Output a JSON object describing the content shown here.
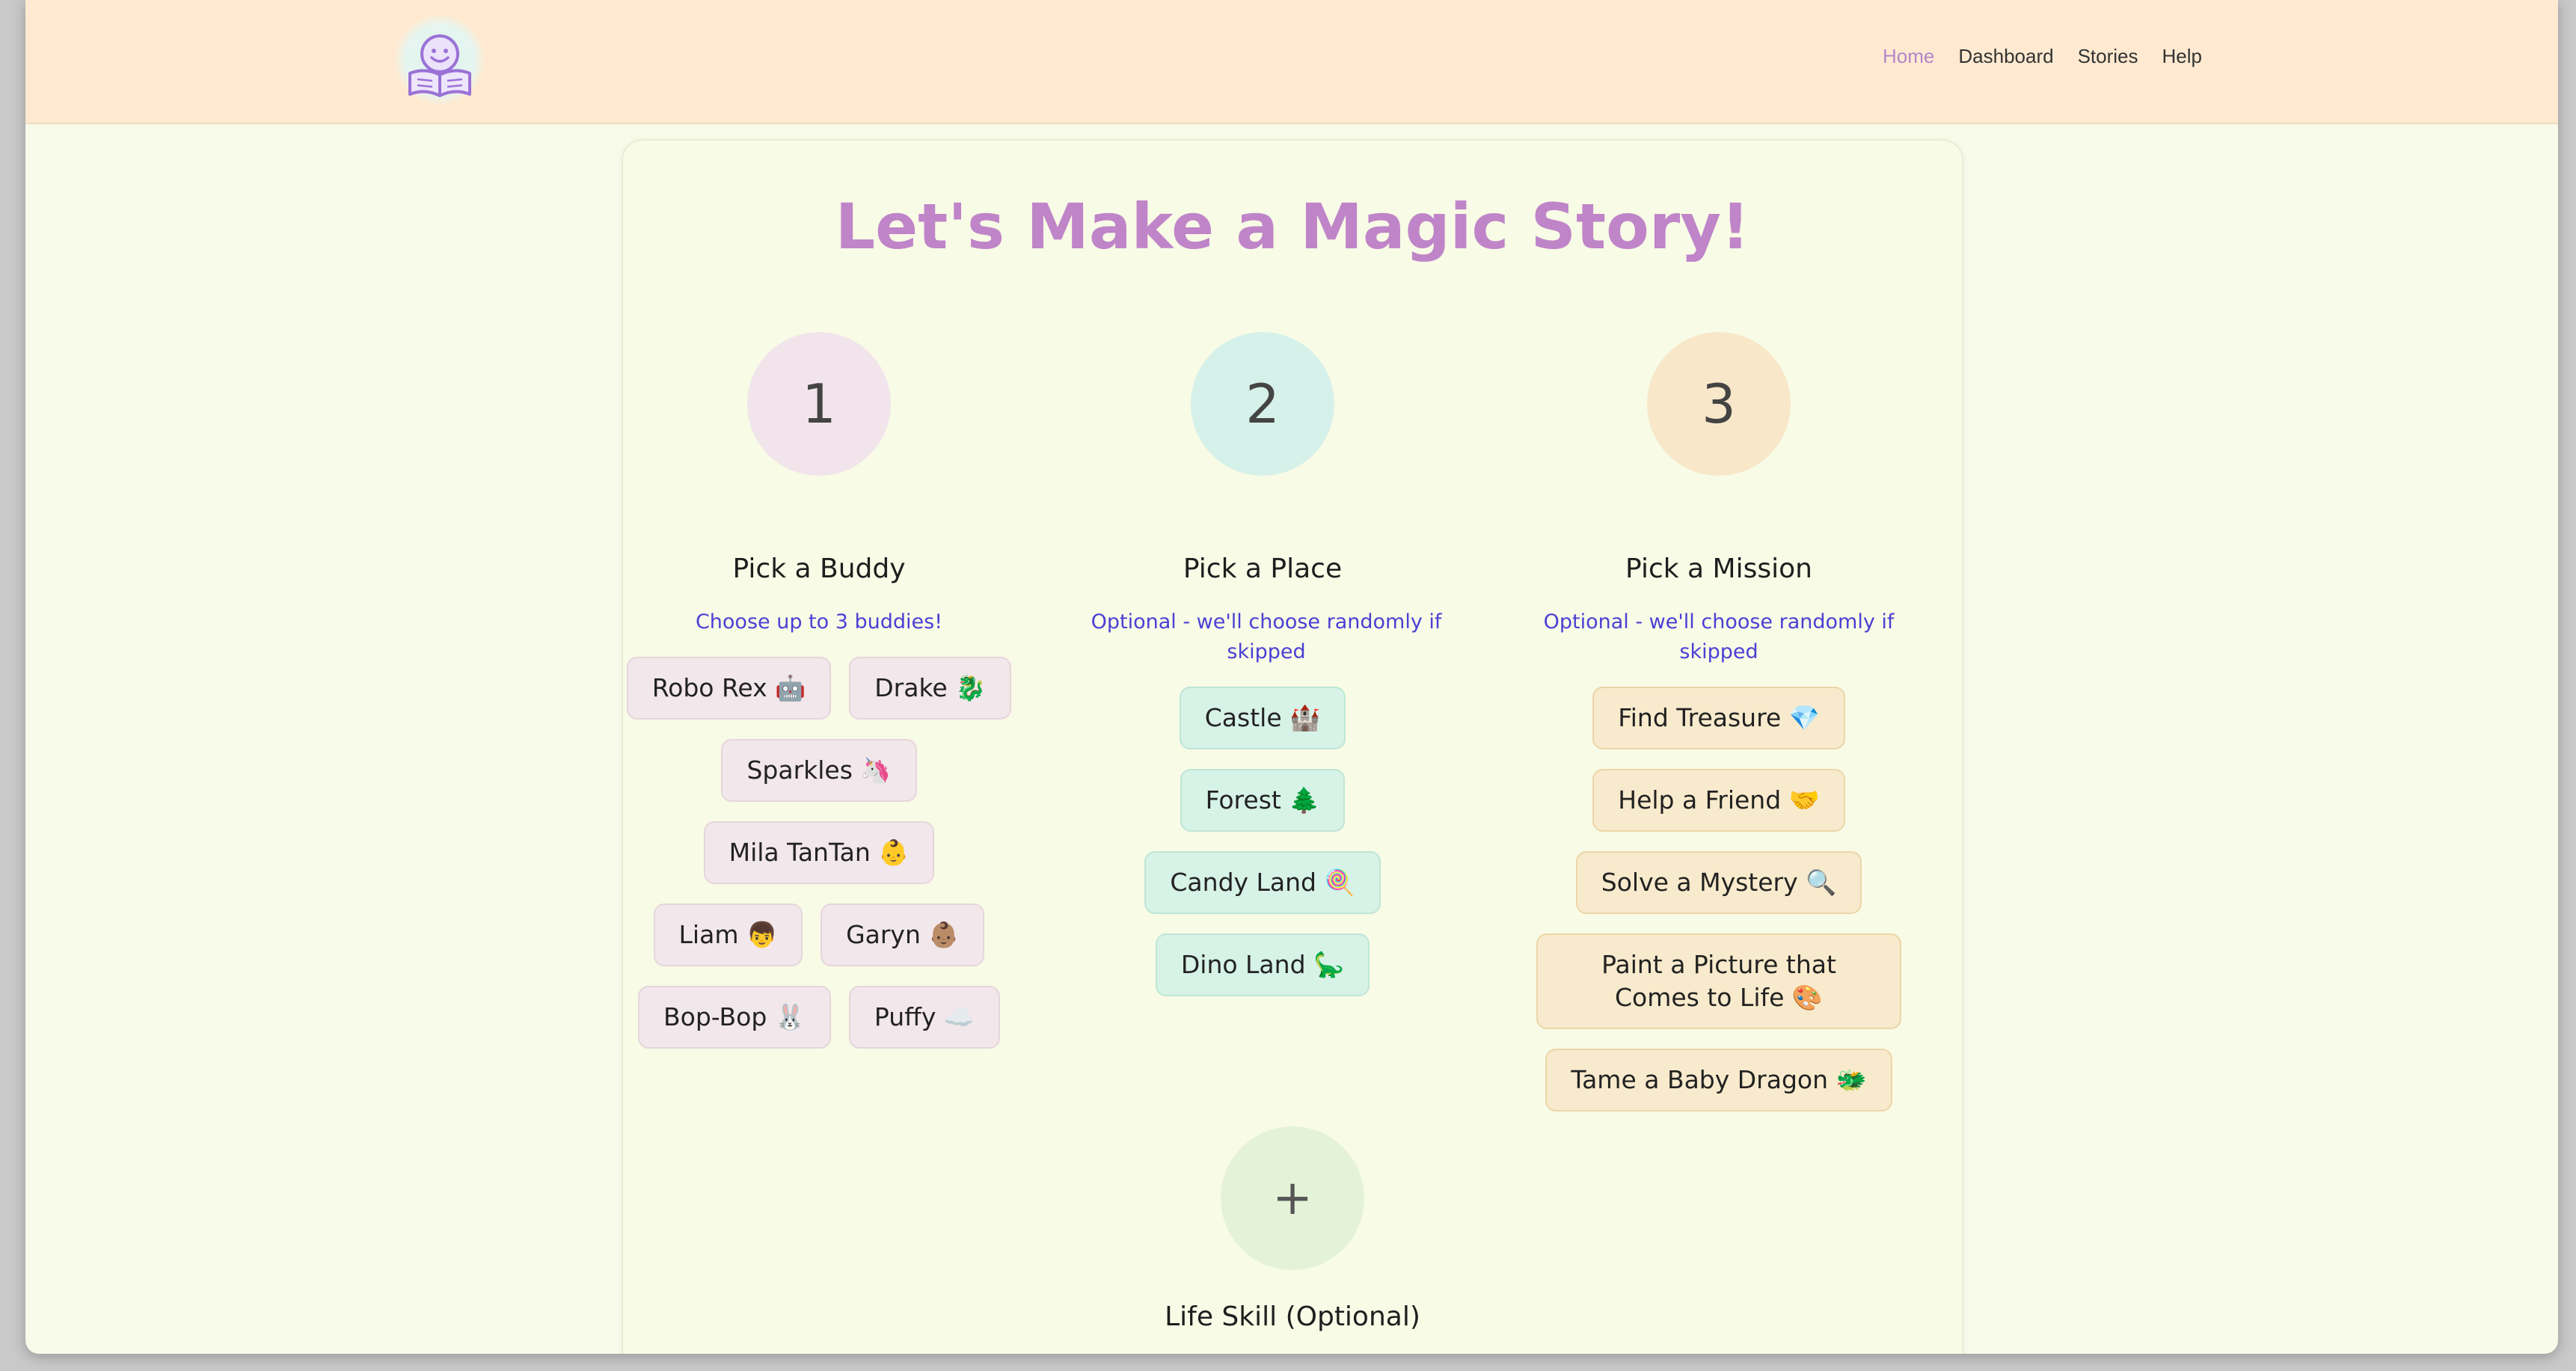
{
  "header": {
    "logo_icon": "reading-child-icon",
    "nav": [
      {
        "label": "Home",
        "active": true
      },
      {
        "label": "Dashboard",
        "active": false
      },
      {
        "label": "Stories",
        "active": false
      },
      {
        "label": "Help",
        "active": false
      }
    ]
  },
  "main": {
    "title": "Let's Make a Magic Story!",
    "steps": [
      {
        "number": "1",
        "title": "Pick a Buddy",
        "subtitle": "Choose up to 3 buddies!",
        "color": "#f1e4eb",
        "options": [
          "Robo Rex 🤖",
          "Drake 🐉",
          "Sparkles 🦄",
          "Mila TanTan 👶",
          "Liam 👦",
          "Garyn 👶🏽",
          "Bop-Bop 🐰",
          "Puffy ☁️"
        ]
      },
      {
        "number": "2",
        "title": "Pick a Place",
        "subtitle": "Optional - we'll choose randomly if skipped",
        "color": "#d6f1e9",
        "options": [
          "Castle 🏰",
          "Forest 🌲",
          "Candy Land 🍭",
          "Dino Land 🦕"
        ]
      },
      {
        "number": "3",
        "title": "Pick a Mission",
        "subtitle": "Optional - we'll choose randomly if skipped",
        "color": "#f8e7c9",
        "options": [
          "Find Treasure 💎",
          "Help a Friend 🤝",
          "Solve a Mystery 🔍",
          "Paint a Picture that Comes to Life 🎨",
          "Tame a Baby Dragon 🐲"
        ]
      }
    ],
    "life_skill": {
      "symbol": "+",
      "title": "Life Skill (Optional)"
    }
  },
  "colors": {
    "header_bg": "#ffead1",
    "page_bg": "#f8fbe9",
    "title": "#bf85c8",
    "subtitle": "#4b3fd4",
    "nav_active": "#b585c9"
  }
}
